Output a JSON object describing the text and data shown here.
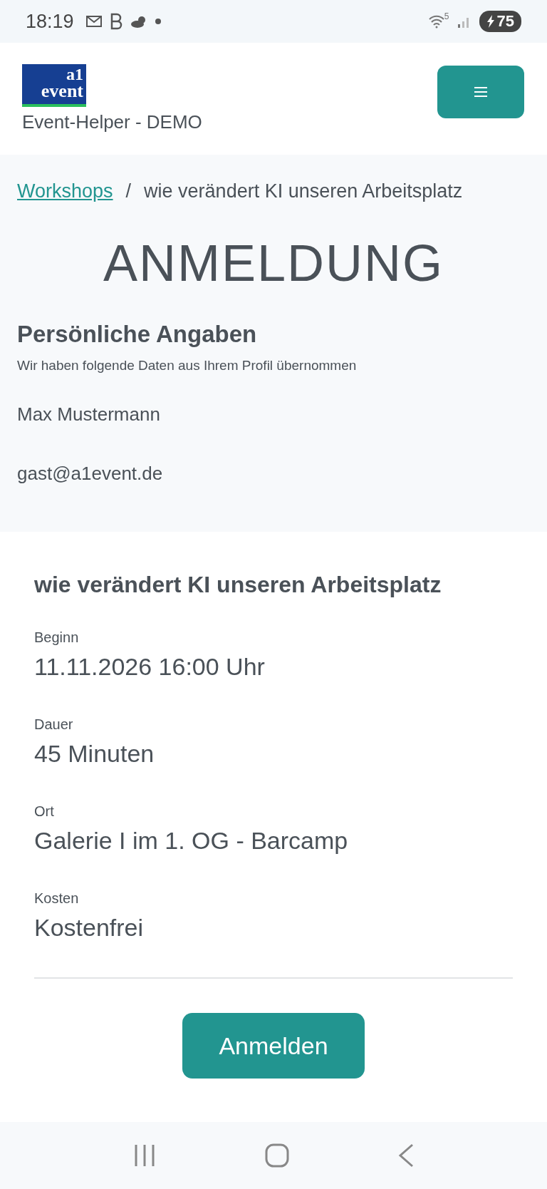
{
  "status_bar": {
    "time": "18:19",
    "wifi_label": "5",
    "battery": "75"
  },
  "header": {
    "logo_top": "a1",
    "logo_bottom": "event",
    "app_name": "Event-Helper - DEMO"
  },
  "breadcrumb": {
    "link": "Workshops",
    "separator": "/",
    "current": "wie verändert KI unseren Arbeitsplatz"
  },
  "page_title": "ANMELDUNG",
  "personal": {
    "heading": "Persönliche Angaben",
    "note": "Wir haben folgende Daten aus Ihrem Profil übernommen",
    "name": "Max Mustermann",
    "email": "gast@a1event.de"
  },
  "event": {
    "title": "wie verändert KI unseren Arbeitsplatz",
    "fields": [
      {
        "label": "Beginn",
        "value": "11.11.2026 16:00 Uhr"
      },
      {
        "label": "Dauer",
        "value": "45 Minuten"
      },
      {
        "label": "Ort",
        "value": "Galerie I im 1. OG - Barcamp"
      },
      {
        "label": "Kosten",
        "value": "Kostenfrei"
      }
    ]
  },
  "button": "Anmelden"
}
